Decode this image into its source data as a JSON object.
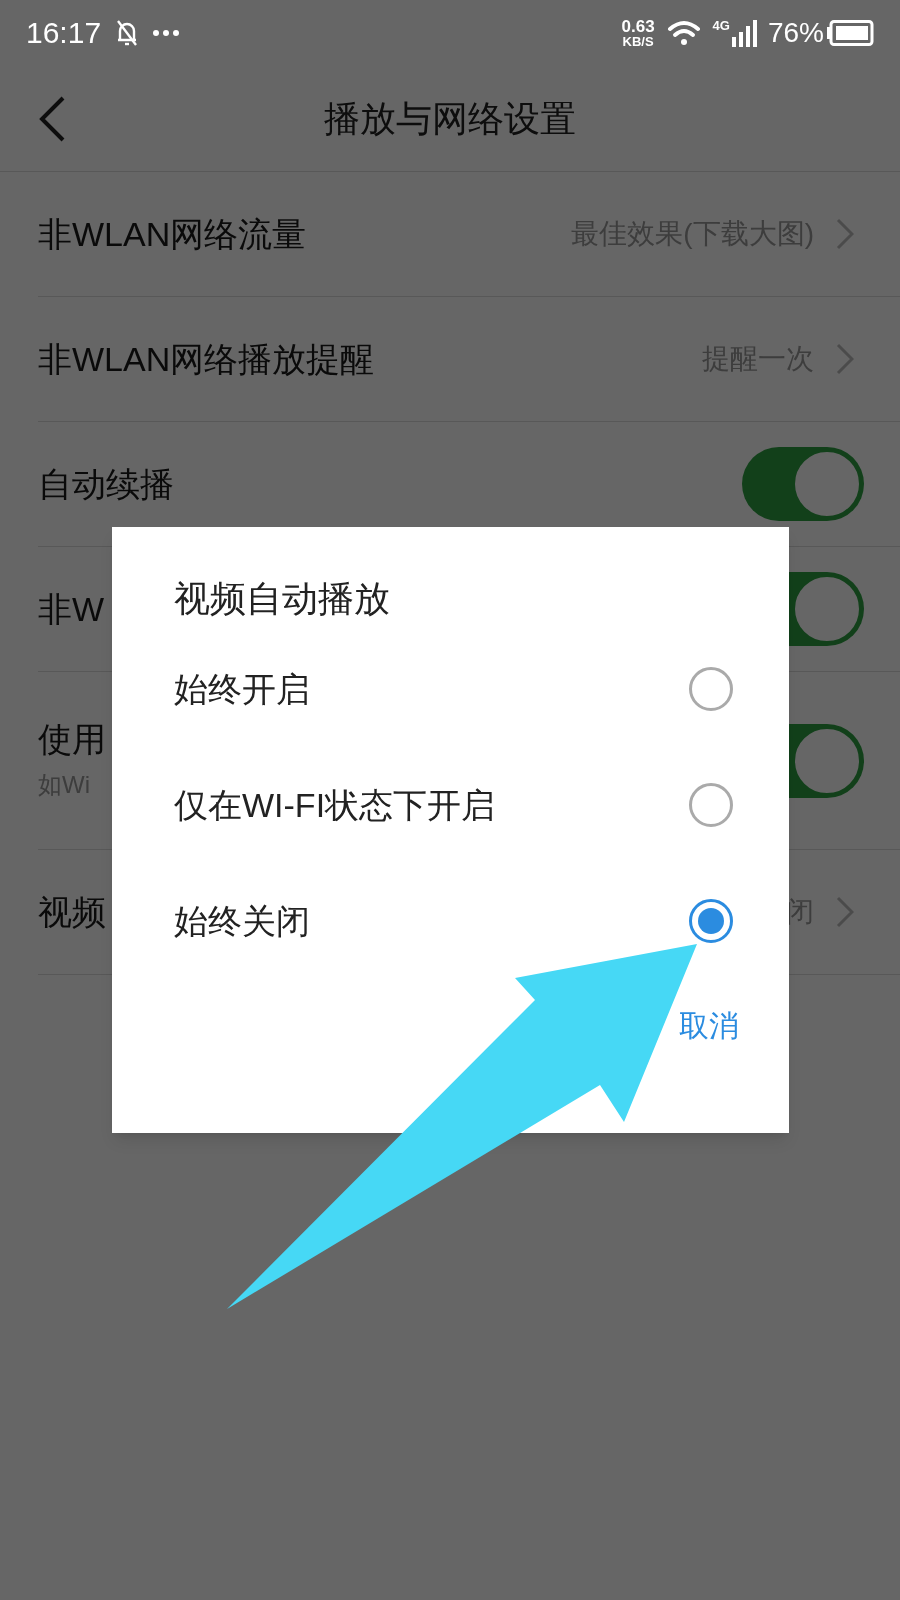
{
  "status_bar": {
    "time": "16:17",
    "speed": "0.63",
    "speed_unit": "KB/S",
    "network": "4G",
    "battery": "76%"
  },
  "header": {
    "title": "播放与网络设置"
  },
  "settings": [
    {
      "kind": "link",
      "label": "非WLAN网络流量",
      "value": "最佳效果(下载大图)"
    },
    {
      "kind": "link",
      "label": "非WLAN网络播放提醒",
      "value": "提醒一次"
    },
    {
      "kind": "toggle",
      "label": "自动续播",
      "on": true
    },
    {
      "kind": "toggle",
      "label": "非W",
      "on": true
    },
    {
      "kind": "toggle",
      "label": "使用",
      "subtitle": "如Wi",
      "on": true
    },
    {
      "kind": "link",
      "label": "视频",
      "value": "闭"
    }
  ],
  "dialog": {
    "title": "视频自动播放",
    "options": [
      {
        "label": "始终开启",
        "selected": false
      },
      {
        "label": "仅在WI-FI状态下开启",
        "selected": false
      },
      {
        "label": "始终关闭",
        "selected": true
      }
    ],
    "cancel": "取消"
  }
}
